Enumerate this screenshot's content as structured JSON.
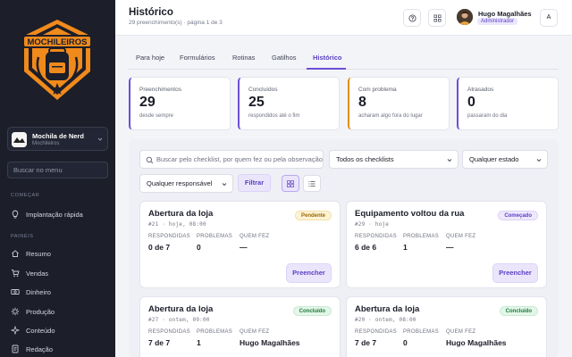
{
  "sidebar": {
    "logo_text": "MOCHILEIROS",
    "store": {
      "name": "Mochila de Nerd",
      "subtitle": "Mochileiros"
    },
    "search_placeholder": "Buscar no menu",
    "sections": [
      {
        "label": "COMEÇAR"
      },
      {
        "label": "PAINÉIS"
      }
    ],
    "items": [
      {
        "label": "Implantação rápida",
        "icon": "lightbulb-icon"
      },
      {
        "label": "Resumo",
        "icon": "home-icon"
      },
      {
        "label": "Vendas",
        "icon": "cart-icon"
      },
      {
        "label": "Dinheiro",
        "icon": "cash-icon"
      },
      {
        "label": "Produção",
        "icon": "gear-icon"
      },
      {
        "label": "Conteúdo",
        "icon": "sparkle-icon"
      },
      {
        "label": "Redação",
        "icon": "document-icon"
      }
    ]
  },
  "header": {
    "title": "Histórico",
    "subtitle": "29 preenchimento(s) · página 1 de 3",
    "user": {
      "name": "Hugo Magalhães",
      "role": "Administrador",
      "initial": "A"
    }
  },
  "tabs": [
    {
      "label": "Para hoje",
      "active": false
    },
    {
      "label": "Formulários",
      "active": false
    },
    {
      "label": "Rotinas",
      "active": false
    },
    {
      "label": "Gatilhos",
      "active": false
    },
    {
      "label": "Histórico",
      "active": true
    }
  ],
  "stats": [
    {
      "label": "Preenchimentos",
      "value": "29",
      "desc": "desde sempre",
      "color": "#6b4fd8"
    },
    {
      "label": "Concluídos",
      "value": "25",
      "desc": "respondidos até o fim",
      "color": "#6b4fd8"
    },
    {
      "label": "Com problema",
      "value": "8",
      "desc": "acharam algo fora do lugar",
      "color": "#e0901d"
    },
    {
      "label": "Atrasados",
      "value": "0",
      "desc": "passaram do dia",
      "color": "#6b4fd8"
    }
  ],
  "filters": {
    "search_placeholder": "Buscar pelo checklist, por quem fez ou pela observação",
    "checklist_select": "Todos os checklists",
    "state_select": "Qualquer estado",
    "responsible_select": "Qualquer responsável",
    "filter_button": "Filtrar"
  },
  "card_labels": {
    "responded": "RESPONDIDAS",
    "problems": "PROBLEMAS",
    "who": "QUEM FEZ",
    "fill_button": "Preencher"
  },
  "cards": [
    {
      "title": "Abertura da loja",
      "meta": "#21 · hoje, 08:00",
      "status": "Pendente",
      "status_kind": "pending",
      "responded": "0 de 7",
      "problems": "0",
      "who": "—",
      "show_button": true
    },
    {
      "title": "Equipamento voltou da rua",
      "meta": "#29 · hoje",
      "status": "Começado",
      "status_kind": "started",
      "responded": "6 de 6",
      "problems": "1",
      "who": "—",
      "show_button": true
    },
    {
      "title": "Abertura da loja",
      "meta": "#27 · ontem, 09:00",
      "status": "Concluído",
      "status_kind": "done",
      "responded": "7 de 7",
      "problems": "1",
      "who": "Hugo Magalhães",
      "show_button": false
    },
    {
      "title": "Abertura da loja",
      "meta": "#20 · ontem, 08:00",
      "status": "Concluído",
      "status_kind": "done",
      "responded": "7 de 7",
      "problems": "0",
      "who": "Hugo Magalhães",
      "show_button": false
    }
  ]
}
